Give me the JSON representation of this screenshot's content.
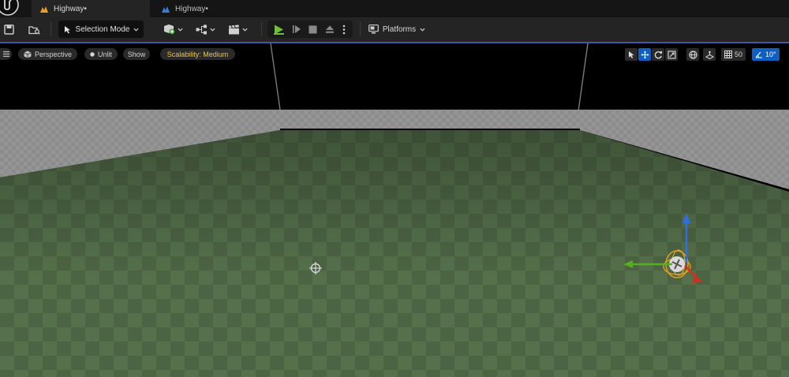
{
  "tabs": [
    {
      "label": "Highway•",
      "active": true,
      "icon": "level-icon"
    },
    {
      "label": "Highway•",
      "active": false,
      "icon": "blueprint-icon"
    }
  ],
  "toolbar": {
    "selection_mode": "Selection Mode",
    "platforms": "Platforms",
    "play_color": "#6fbf3a"
  },
  "viewport": {
    "perspective": "Perspective",
    "unlit": "Unlit",
    "show": "Show",
    "scalability": "Scalability: Medium",
    "grid_snap": "50",
    "rotation_snap": "10°",
    "accent": "#0f5fc0",
    "ground_color": "#4d6444",
    "wall_color": "#8f8f8f"
  }
}
